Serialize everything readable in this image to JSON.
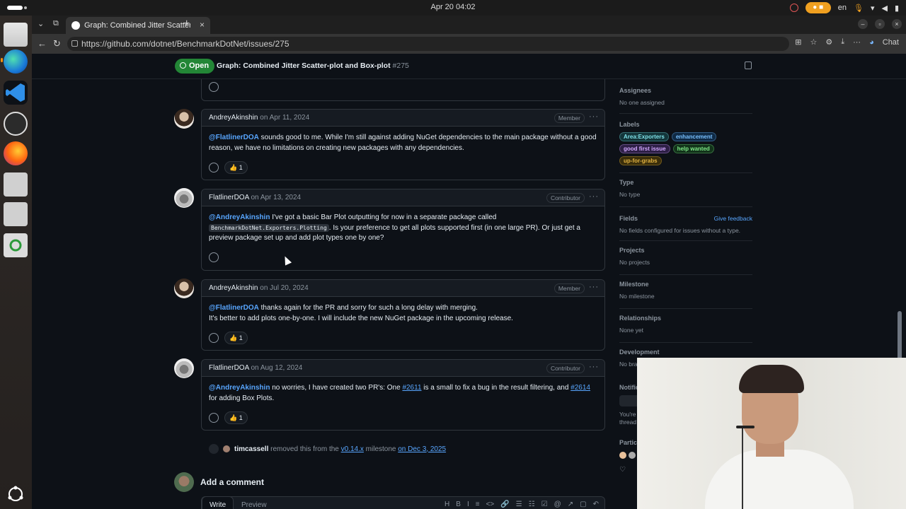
{
  "os": {
    "clock": "Apr 20  04:02",
    "lang": "en"
  },
  "browser": {
    "tab_title": "Graph: Combined Jitter Scatter-plot and Box-plot",
    "url": "https://github.com/dotnet/BenchmarkDotNet/issues/275",
    "chat_label": "Chat"
  },
  "issue": {
    "state": "Open",
    "title": "Graph: Combined Jitter Scatter-plot and Box-plot",
    "number": "#275"
  },
  "comments": [
    {
      "author": "AndreyAkinshin",
      "date": "on Apr 11, 2024",
      "role": "Member",
      "mention": "@FlatlinerDOA",
      "text": " sounds good to me. While I'm still against adding NuGet dependencies to the main package without a good reason, we have no limitations on creating new packages with any dependencies.",
      "reaction": "👍 1"
    },
    {
      "author": "FlatlinerDOA",
      "date": "on Apr 13, 2024",
      "role": "Contributor",
      "mention": "@AndreyAkinshin",
      "text1": " I've got a basic Bar Plot outputting for now in a separate package called",
      "code": "BenchmarkDotNet.Exporters.Plotting",
      "text2": ". Is your preference to get all plots supported first (in one large PR). Or just get a preview package set up and add plot types one by one?"
    },
    {
      "author": "AndreyAkinshin",
      "date": "on Jul 20, 2024",
      "role": "Member",
      "mention": "@FlatlinerDOA",
      "text1": " thanks again for the PR and sorry for such a long delay with merging.",
      "text2": "It's better to add plots one-by-one. I will include the new NuGet package in the upcoming release.",
      "reaction": "👍 1"
    },
    {
      "author": "FlatlinerDOA",
      "date": "on Aug 12, 2024",
      "role": "Contributor",
      "mention": "@AndreyAkinshin",
      "text1": " no worries, I have created two PR's: One ",
      "link1": "#2611",
      "text2": " is a small to fix a bug in the result filtering, and ",
      "link2": "#2614",
      "text3": " for adding Box Plots.",
      "reaction": "👍 1"
    }
  ],
  "event": {
    "actor": "timcassell",
    "text1": " removed this from the ",
    "milestone": "v0.14.x",
    "text2": " milestone ",
    "date": "on Dec 3, 2025"
  },
  "add_comment": {
    "title": "Add a comment",
    "write": "Write",
    "preview": "Preview",
    "tools": [
      "H",
      "B",
      "I",
      "≡",
      "<>",
      "🔗",
      "☰",
      "☷",
      "☑",
      "@",
      "↗",
      "▢",
      "↶"
    ]
  },
  "sidebar": {
    "assignees": {
      "heading": "Assignees",
      "value": "No one assigned"
    },
    "labels": {
      "heading": "Labels",
      "items": [
        {
          "name": "Area:Exporters",
          "color": "#7ee0e8",
          "bg": "#13353a"
        },
        {
          "name": "enhancement",
          "color": "#79c0ff",
          "bg": "#0f2a45"
        },
        {
          "name": "good first issue",
          "color": "#d2a8ff",
          "bg": "#2d1f45"
        },
        {
          "name": "help wanted",
          "color": "#7ee787",
          "bg": "#12331a"
        },
        {
          "name": "up-for-grabs",
          "color": "#e3b341",
          "bg": "#3a2e0b"
        }
      ]
    },
    "type": {
      "heading": "Type",
      "value": "No type"
    },
    "fields": {
      "heading": "Fields",
      "feedback": "Give feedback",
      "value": "No fields configured for issues without a type."
    },
    "projects": {
      "heading": "Projects",
      "value": "No projects"
    },
    "milestone": {
      "heading": "Milestone",
      "value": "No milestone"
    },
    "relationships": {
      "heading": "Relationships",
      "value": "None yet"
    },
    "development": {
      "heading": "Development",
      "value": "No bra"
    },
    "notifications": {
      "heading": "Notific",
      "value1": "You're",
      "value2": "thread"
    },
    "participants": {
      "heading": "Partic"
    }
  }
}
